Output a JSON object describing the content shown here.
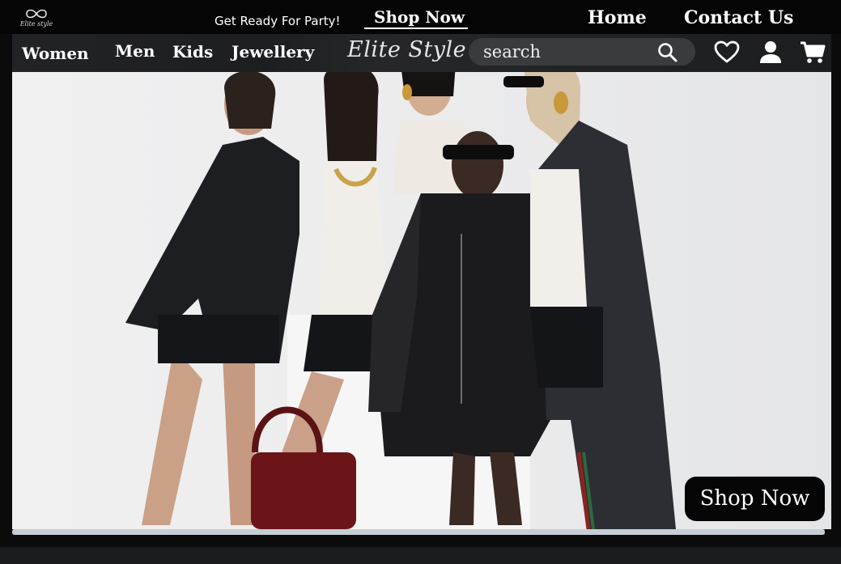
{
  "brand": {
    "logo_text": "Elite style",
    "logo_icon": "infinity-icon",
    "name": "Elite Style"
  },
  "topbar": {
    "promo_text": "Get Ready For Party!",
    "promo_link": "Shop Now",
    "links": {
      "home": "Home",
      "contact": "Contact Us"
    }
  },
  "nav": {
    "items": [
      {
        "label": "Women"
      },
      {
        "label": "Men"
      },
      {
        "label": "Kids"
      },
      {
        "label": "Jewellery"
      }
    ]
  },
  "search": {
    "placeholder": "search",
    "value": "",
    "icon": "search-icon"
  },
  "icons": {
    "wishlist": "heart-icon",
    "account": "user-icon",
    "cart": "cart-icon"
  },
  "hero": {
    "image": "fashion-models-photo",
    "cta_label": "Shop Now",
    "slide_progress": 1.0
  },
  "colors": {
    "background": "#0b0b0c",
    "navbar": "#222326",
    "search_bg": "#3a3b3d",
    "accent": "#ffffff"
  }
}
